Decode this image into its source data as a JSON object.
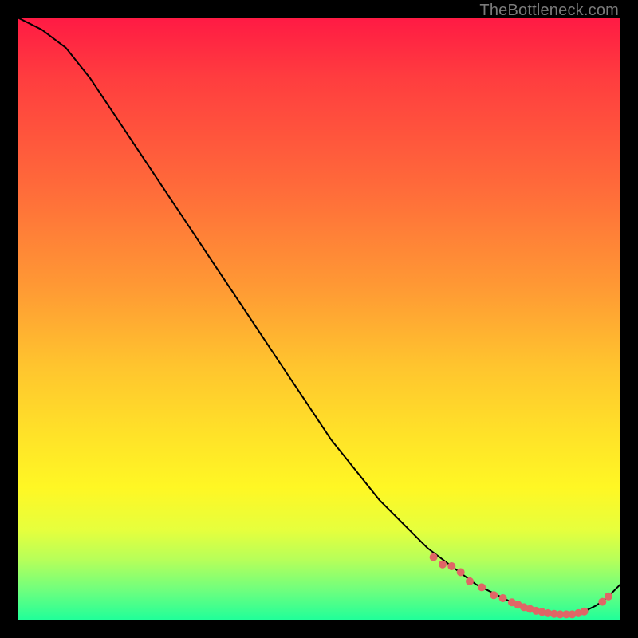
{
  "watermark": "TheBottleneck.com",
  "colors": {
    "line": "#000000",
    "marker_fill": "#e06666",
    "background": "#000000"
  },
  "chart_data": {
    "type": "line",
    "title": "",
    "xlabel": "",
    "ylabel": "",
    "xlim": [
      0,
      100
    ],
    "ylim": [
      0,
      100
    ],
    "x": [
      0,
      4,
      8,
      12,
      16,
      20,
      24,
      28,
      32,
      36,
      40,
      44,
      48,
      52,
      56,
      60,
      64,
      68,
      72,
      76,
      80,
      82,
      84,
      86,
      88,
      90,
      92,
      94,
      96,
      98,
      100
    ],
    "values": [
      100,
      98,
      95,
      90,
      84,
      78,
      72,
      66,
      60,
      54,
      48,
      42,
      36,
      30,
      25,
      20,
      16,
      12,
      9,
      6,
      4,
      3.0,
      2.2,
      1.6,
      1.2,
      1.0,
      1.0,
      1.5,
      2.5,
      4.0,
      6.0
    ],
    "markers": {
      "x": [
        69,
        70.5,
        72,
        73.5,
        75,
        77,
        79,
        80.5,
        82,
        83,
        84,
        85,
        86,
        87,
        88,
        89,
        90,
        91,
        92,
        93,
        94,
        97,
        98
      ],
      "values": [
        10.5,
        9.3,
        9.0,
        8.0,
        6.5,
        5.5,
        4.2,
        3.7,
        3.0,
        2.6,
        2.2,
        1.9,
        1.6,
        1.4,
        1.2,
        1.1,
        1.0,
        1.0,
        1.0,
        1.2,
        1.5,
        3.1,
        4.0
      ],
      "radius": [
        5,
        5,
        5,
        5,
        5,
        5,
        5,
        5,
        5,
        5,
        5,
        5,
        5,
        5,
        5,
        5,
        5,
        5,
        5,
        5,
        5,
        5,
        5
      ]
    }
  }
}
